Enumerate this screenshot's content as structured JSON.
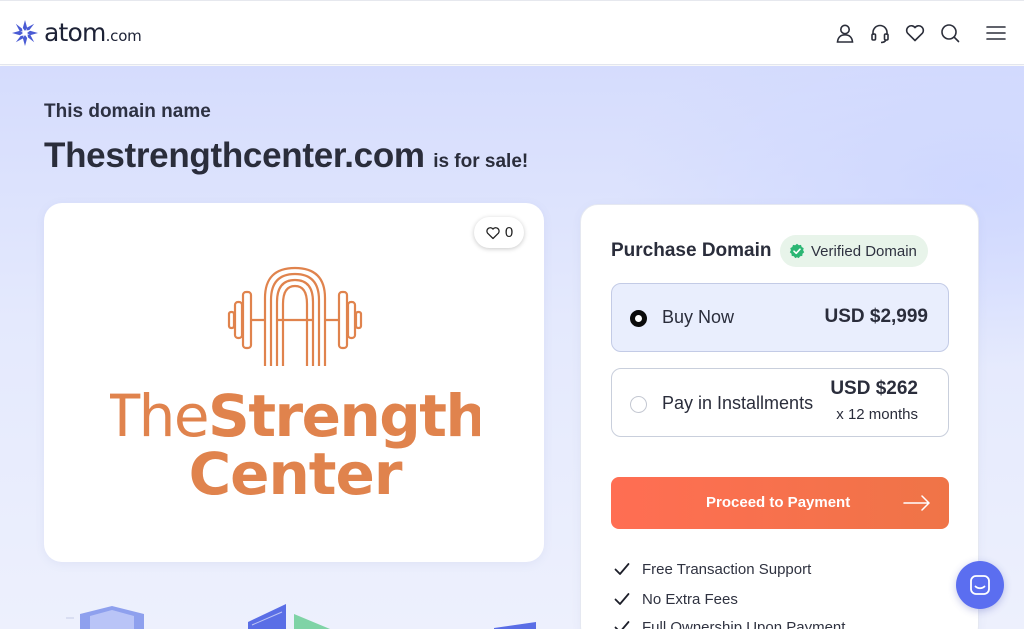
{
  "header": {
    "brand": "atom",
    "brand_tld": ".com",
    "icons": [
      "user-icon",
      "headset-icon",
      "heart-icon",
      "search-icon",
      "menu-icon"
    ]
  },
  "hero": {
    "eyebrow": "This domain name",
    "domain": "Thestrengthcenter.com",
    "suffix": "is for sale!"
  },
  "logo_card": {
    "likes": "0",
    "brand_line1_a": "The",
    "brand_line1_b": "Strength",
    "brand_line2": "Center",
    "brand_color": "#e0834d"
  },
  "purchase": {
    "title": "Purchase Domain",
    "verified": "Verified Domain",
    "options": [
      {
        "label": "Buy Now",
        "price": "USD $2,999",
        "selected": true
      },
      {
        "label": "Pay in Installments",
        "price": "USD $262",
        "term": "x 12 months",
        "selected": false
      }
    ],
    "cta": "Proceed to Payment",
    "features": [
      "Free Transaction Support",
      "No Extra Fees",
      "Full Ownership Upon Payment"
    ]
  },
  "colors": {
    "accent": "#ff6e53",
    "verified_green": "#2bb673",
    "chat": "#5b6ef0",
    "brand_blue": "#4a5bd4"
  }
}
